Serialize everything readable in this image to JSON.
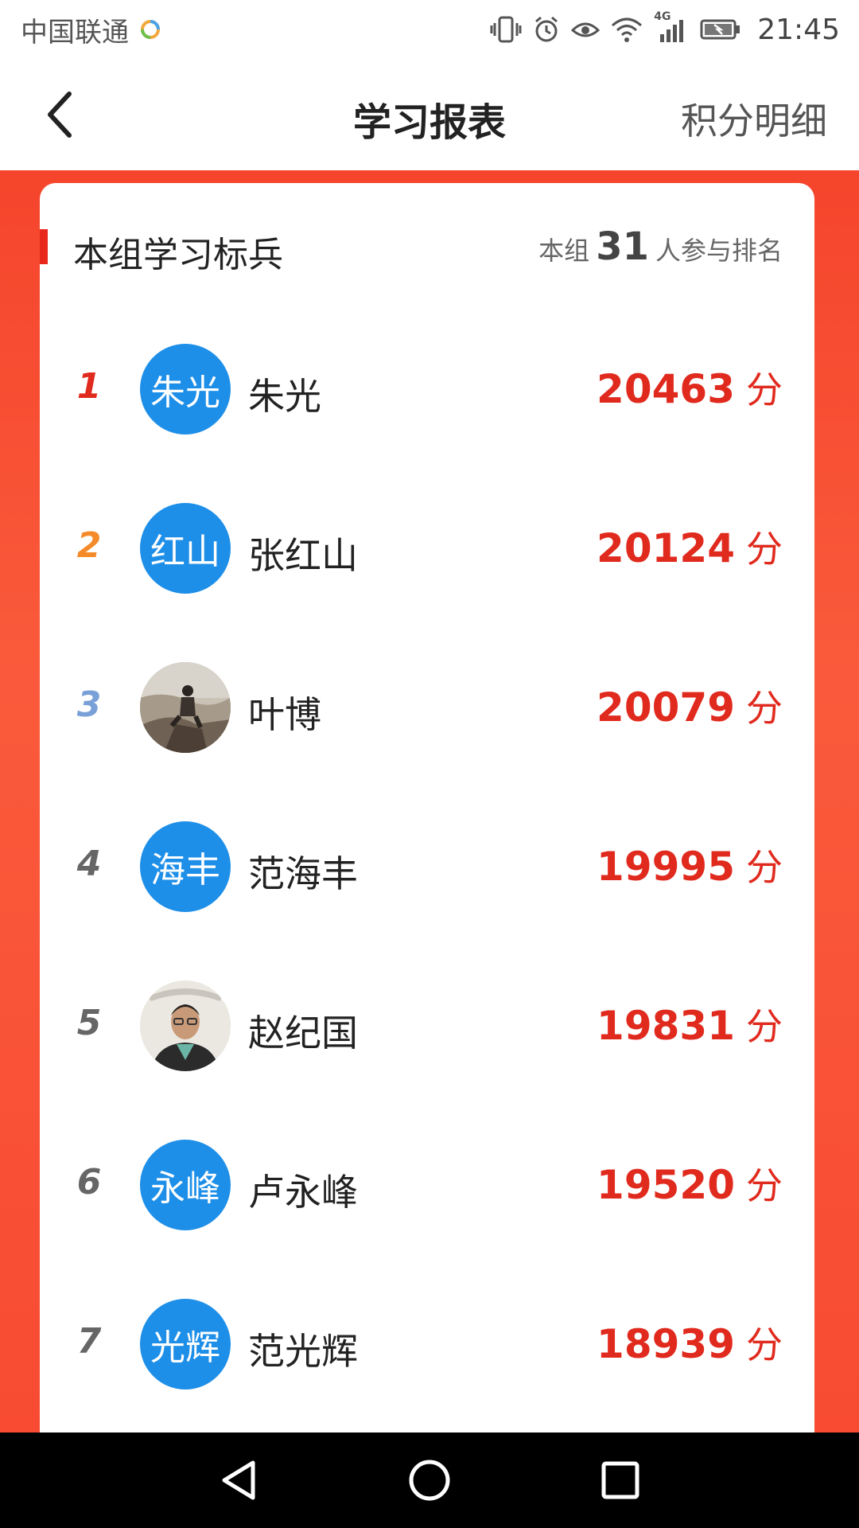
{
  "status_bar": {
    "carrier": "中国联通",
    "network": "4G",
    "time": "21:45"
  },
  "nav": {
    "title": "学习报表",
    "right_link": "积分明细"
  },
  "card": {
    "title": "本组学习标兵",
    "participants_prefix": "本组",
    "participants_count": "31",
    "participants_suffix": "人参与排名"
  },
  "colors": {
    "accent_red": "#e12a1e",
    "background_red": "#f84b32",
    "avatar_blue": "#1e8fe8",
    "rank1": "#e12a1e",
    "rank2": "#f58a2a",
    "rank3": "#7aa0d8",
    "rank_other": "#666666"
  },
  "rankings": [
    {
      "rank": "1",
      "avatar_text": "朱光",
      "avatar_type": "text",
      "name": "朱光",
      "score": "20463",
      "unit": "分"
    },
    {
      "rank": "2",
      "avatar_text": "红山",
      "avatar_type": "text",
      "name": "张红山",
      "score": "20124",
      "unit": "分"
    },
    {
      "rank": "3",
      "avatar_text": "",
      "avatar_type": "photo-landscape",
      "name": "叶博",
      "score": "20079",
      "unit": "分"
    },
    {
      "rank": "4",
      "avatar_text": "海丰",
      "avatar_type": "text",
      "name": "范海丰",
      "score": "19995",
      "unit": "分"
    },
    {
      "rank": "5",
      "avatar_text": "",
      "avatar_type": "photo-person",
      "name": "赵纪国",
      "score": "19831",
      "unit": "分"
    },
    {
      "rank": "6",
      "avatar_text": "永峰",
      "avatar_type": "text",
      "name": "卢永峰",
      "score": "19520",
      "unit": "分"
    },
    {
      "rank": "7",
      "avatar_text": "光辉",
      "avatar_type": "text",
      "name": "范光辉",
      "score": "18939",
      "unit": "分"
    }
  ]
}
